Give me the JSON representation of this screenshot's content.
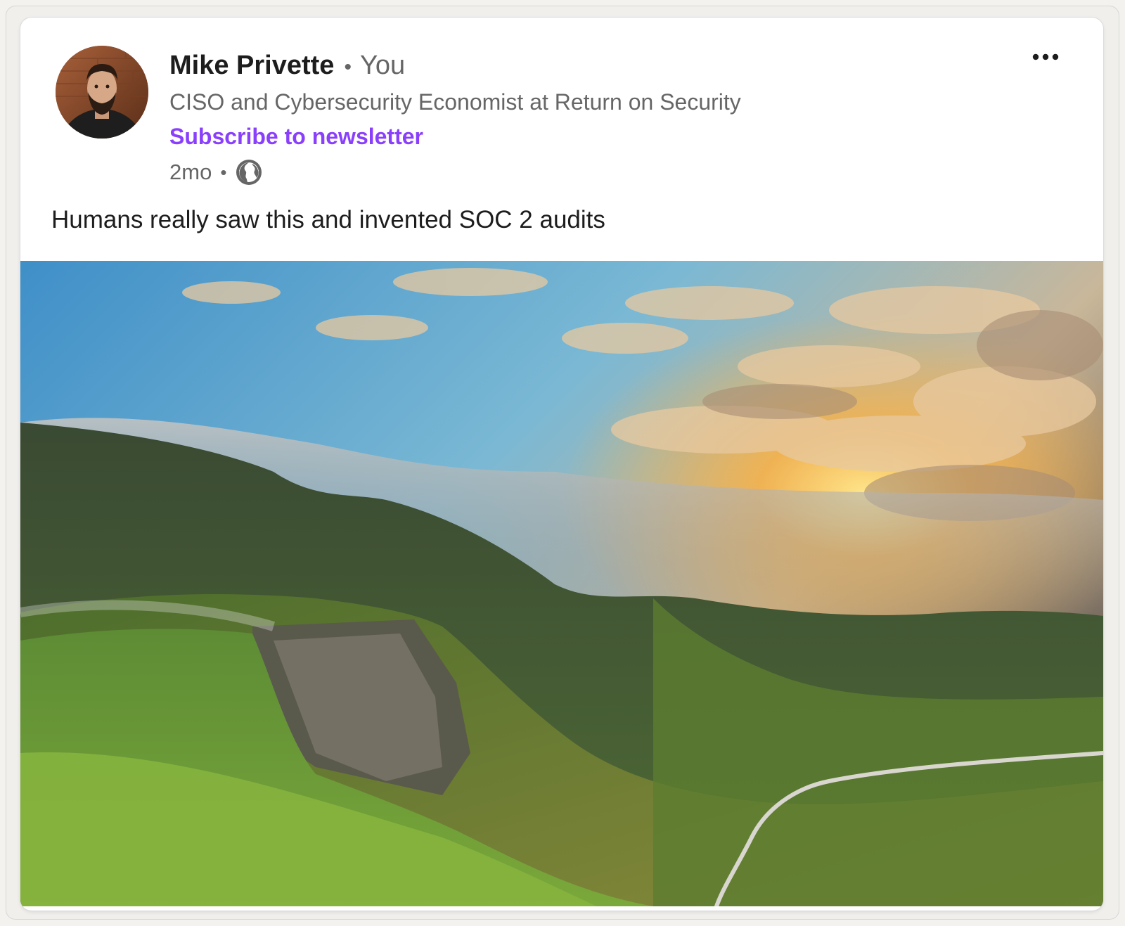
{
  "post": {
    "author": {
      "name": "Mike Privette",
      "separator": "•",
      "relation": "You",
      "headline": "CISO and Cybersecurity Economist at Return on Security",
      "subscribe_label": "Subscribe to newsletter",
      "timestamp": "2mo",
      "meta_separator": "•",
      "visibility_icon": "globe-icon"
    },
    "more_icon": "more-horizontal-icon",
    "text": "Humans really saw this and invented SOC 2 audits",
    "image": {
      "subject": "landscape photo"
    }
  },
  "colors": {
    "subscribe_link": "#8a3ffc",
    "secondary_text": "#666666",
    "primary_text": "#1d1d1d",
    "card_background": "#ffffff",
    "page_background": "#f3f2ef"
  }
}
